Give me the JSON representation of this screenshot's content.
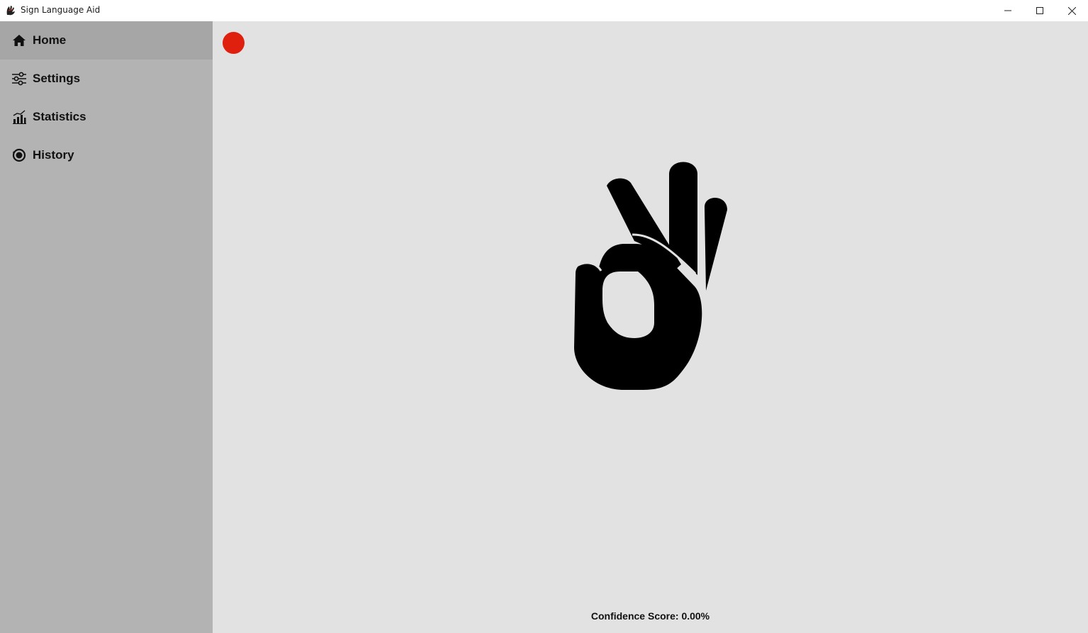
{
  "window": {
    "title": "Sign Language Aid",
    "controls": {
      "minimize_icon": "minimize-icon",
      "maximize_icon": "maximize-icon",
      "close_icon": "close-icon"
    }
  },
  "sidebar": {
    "background": "#b3b3b3",
    "active_background": "#a6a6a6",
    "items": [
      {
        "label": "Home",
        "icon": "home-icon",
        "active": true
      },
      {
        "label": "Settings",
        "icon": "sliders-icon",
        "active": false
      },
      {
        "label": "Statistics",
        "icon": "bar-chart-icon",
        "active": false
      },
      {
        "label": "History",
        "icon": "history-icon",
        "active": false
      }
    ]
  },
  "main": {
    "background": "#e2e2e2",
    "record_indicator_color": "#e0200f",
    "sign_image": "ok-hand-sign-icon",
    "confidence_label": "Confidence Score: 0.00%"
  }
}
